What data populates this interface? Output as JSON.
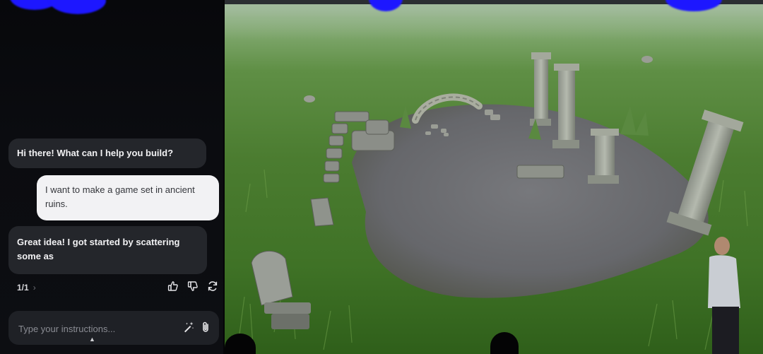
{
  "chat": {
    "greeting": "Hi there! What can I help you build?",
    "user_message": "I want to make a game set in ancient ruins.",
    "assistant_reply": "Great idea! I got started by scattering some as",
    "page_count": "1/1",
    "page_chevron": "›"
  },
  "composer": {
    "placeholder": "Type your instructions..."
  },
  "icons": {
    "like": "thumbs-up-icon",
    "dislike": "thumbs-down-icon",
    "regenerate": "refresh-icon",
    "magic": "sparkle-wand-icon",
    "attach": "paperclip-icon"
  },
  "colors": {
    "panel_bg": "#0b0c10",
    "assistant_bubble": "#24262b",
    "user_bubble": "#f2f2f4",
    "composer_bg": "#1f2126",
    "grass": "#4b7c30",
    "ground": "#6e7077"
  }
}
